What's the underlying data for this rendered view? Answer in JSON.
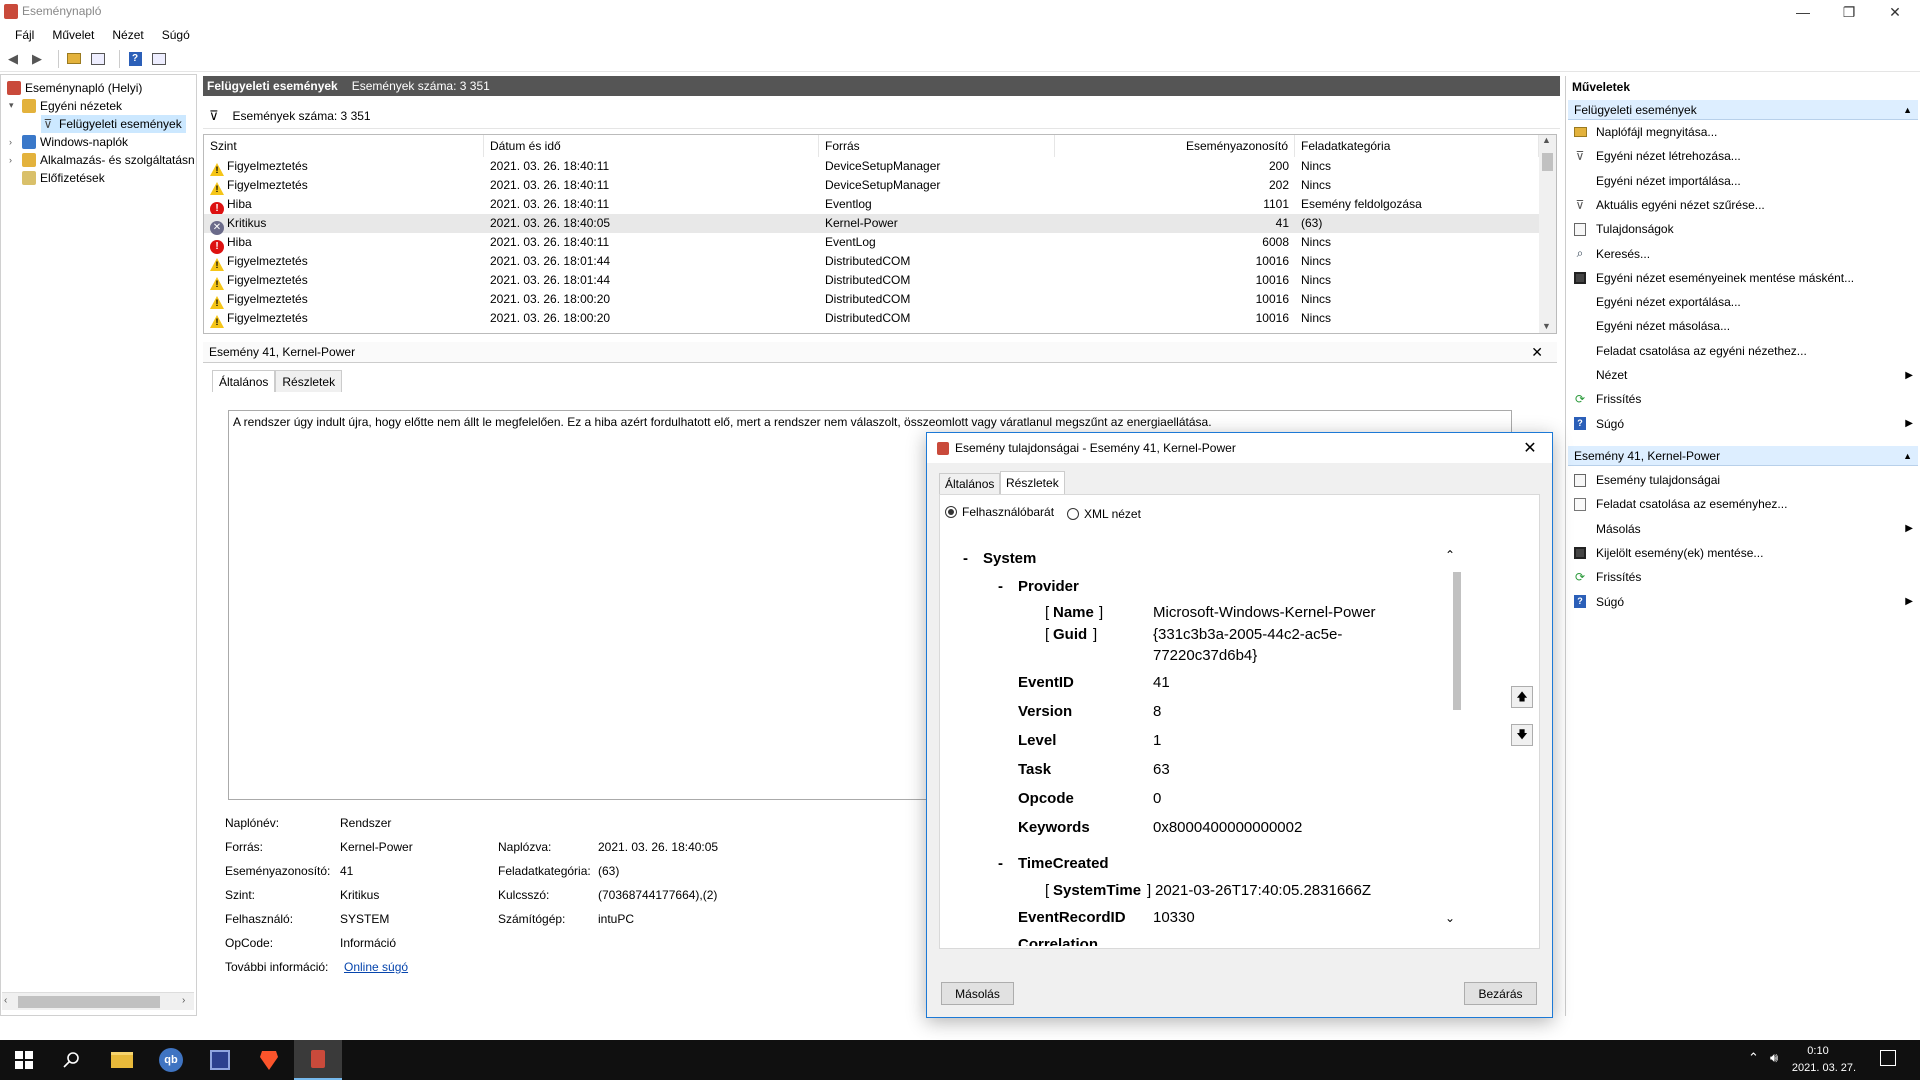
{
  "window": {
    "title": "Eseménynapló",
    "minimize": "—",
    "maximize": "❐",
    "close": "✕"
  },
  "menu": [
    "Fájl",
    "Művelet",
    "Nézet",
    "Súgó"
  ],
  "tree": {
    "root": "Eseménynapló (Helyi)",
    "custom_views": "Egyéni nézetek",
    "admin_events": "Felügyeleti események",
    "windows_logs": "Windows-naplók",
    "app_logs": "Alkalmazás- és szolgáltatásn",
    "subscriptions": "Előfizetések"
  },
  "center": {
    "header_title": "Felügyeleti események",
    "header_count": "Események száma: 3 351",
    "filter_text": "Események száma: 3 351"
  },
  "grid": {
    "columns": [
      "Szint",
      "Dátum és idő",
      "Forrás",
      "Eseményazonosító",
      "Feladatkategória"
    ],
    "rows": [
      {
        "level": "Figyelmeztetés",
        "type": "warn",
        "date": "2021. 03. 26. 18:40:11",
        "source": "DeviceSetupManager",
        "id": "200",
        "task": "Nincs"
      },
      {
        "level": "Figyelmeztetés",
        "type": "warn",
        "date": "2021. 03. 26. 18:40:11",
        "source": "DeviceSetupManager",
        "id": "202",
        "task": "Nincs"
      },
      {
        "level": "Hiba",
        "type": "err",
        "date": "2021. 03. 26. 18:40:11",
        "source": "Eventlog",
        "id": "1101",
        "task": "Esemény feldolgozása"
      },
      {
        "level": "Kritikus",
        "type": "crit",
        "date": "2021. 03. 26. 18:40:05",
        "source": "Kernel-Power",
        "id": "41",
        "task": "(63)"
      },
      {
        "level": "Hiba",
        "type": "err",
        "date": "2021. 03. 26. 18:40:11",
        "source": "EventLog",
        "id": "6008",
        "task": "Nincs"
      },
      {
        "level": "Figyelmeztetés",
        "type": "warn",
        "date": "2021. 03. 26. 18:01:44",
        "source": "DistributedCOM",
        "id": "10016",
        "task": "Nincs"
      },
      {
        "level": "Figyelmeztetés",
        "type": "warn",
        "date": "2021. 03. 26. 18:01:44",
        "source": "DistributedCOM",
        "id": "10016",
        "task": "Nincs"
      },
      {
        "level": "Figyelmeztetés",
        "type": "warn",
        "date": "2021. 03. 26. 18:00:20",
        "source": "DistributedCOM",
        "id": "10016",
        "task": "Nincs"
      },
      {
        "level": "Figyelmeztetés",
        "type": "warn",
        "date": "2021. 03. 26. 18:00:20",
        "source": "DistributedCOM",
        "id": "10016",
        "task": "Nincs"
      }
    ]
  },
  "detail": {
    "title": "Esemény 41, Kernel-Power",
    "tab_general": "Általános",
    "tab_details": "Részletek",
    "description": "A rendszer úgy indult újra, hogy előtte nem állt le megfelelően. Ez a hiba azért fordulhatott elő, mert a rendszer nem válaszolt, összeomlott vagy váratlanul megszűnt az energiaellátása.",
    "labels": {
      "log": "Naplónév:",
      "source": "Forrás:",
      "event_id": "Eseményazonosító:",
      "level": "Szint:",
      "user": "Felhasználó:",
      "opcode": "OpCode:",
      "more_info": "További információ:",
      "logged": "Naplózva:",
      "task": "Feladatkategória:",
      "keywords": "Kulcsszó:",
      "computer": "Számítógép:"
    },
    "values": {
      "log": "Rendszer",
      "source": "Kernel-Power",
      "event_id": "41",
      "level": "Kritikus",
      "user": "SYSTEM",
      "opcode": "Információ",
      "more_info": "Online súgó",
      "logged": "2021. 03. 26. 18:40:05",
      "task": "(63)",
      "keywords": "(70368744177664),(2)",
      "computer": "intuPC"
    }
  },
  "actions": {
    "title": "Műveletek",
    "section1": "Felügyeleti események",
    "items1": [
      {
        "label": "Naplófájl megnyitása...",
        "icon": "folder-icon",
        "arrow": false
      },
      {
        "label": "Egyéni nézet létrehozása...",
        "icon": "filter-icon",
        "arrow": false
      },
      {
        "label": "Egyéni nézet importálása...",
        "icon": "blank-icon",
        "arrow": false
      },
      {
        "label": "Aktuális egyéni nézet szűrése...",
        "icon": "filter-icon",
        "arrow": false
      },
      {
        "label": "Tulajdonságok",
        "icon": "properties-icon",
        "arrow": false
      },
      {
        "label": "Keresés...",
        "icon": "find-icon",
        "arrow": false
      },
      {
        "label": "Egyéni nézet eseményeinek mentése másként...",
        "icon": "save-icon",
        "arrow": false
      },
      {
        "label": "Egyéni nézet exportálása...",
        "icon": "blank-icon",
        "arrow": false
      },
      {
        "label": "Egyéni nézet másolása...",
        "icon": "blank-icon",
        "arrow": false
      },
      {
        "label": "Feladat csatolása az egyéni nézethez...",
        "icon": "blank-icon",
        "arrow": false
      },
      {
        "label": "Nézet",
        "icon": "blank-icon",
        "arrow": true
      },
      {
        "label": "Frissítés",
        "icon": "refresh-icon",
        "arrow": false
      },
      {
        "label": "Súgó",
        "icon": "help-icon",
        "arrow": true
      }
    ],
    "section2": "Esemény 41, Kernel-Power",
    "items2": [
      {
        "label": "Esemény tulajdonságai",
        "icon": "properties-icon",
        "arrow": false
      },
      {
        "label": "Feladat csatolása az eseményhez...",
        "icon": "task-icon",
        "arrow": false
      },
      {
        "label": "Másolás",
        "icon": "blank-icon",
        "arrow": true
      },
      {
        "label": "Kijelölt esemény(ek) mentése...",
        "icon": "save-icon",
        "arrow": false
      },
      {
        "label": "Frissítés",
        "icon": "refresh-icon",
        "arrow": false
      },
      {
        "label": "Súgó",
        "icon": "help-icon",
        "arrow": true
      }
    ]
  },
  "dialog": {
    "title": "Esemény tulajdonságai - Esemény 41, Kernel-Power",
    "tab_general": "Általános",
    "tab_details": "Részletek",
    "radio_friendly": "Felhasználóbarát",
    "radio_xml": "XML nézet",
    "system": "System",
    "provider": "Provider",
    "name_key": "Name",
    "name_val": "Microsoft-Windows-Kernel-Power",
    "guid_key": "Guid",
    "guid_val1": "{331c3b3a-2005-44c2-ac5e-",
    "guid_val2": "77220c37d6b4}",
    "fields": [
      {
        "k": "EventID",
        "v": "41"
      },
      {
        "k": "Version",
        "v": "8"
      },
      {
        "k": "Level",
        "v": "1"
      },
      {
        "k": "Task",
        "v": "63"
      },
      {
        "k": "Opcode",
        "v": "0"
      },
      {
        "k": "Keywords",
        "v": "0x8000400000000002"
      }
    ],
    "timecreated": "TimeCreated",
    "systemtime_key": "SystemTime",
    "systemtime_val": "2021-03-26T17:40:05.2831666Z",
    "recordid_key": "EventRecordID",
    "recordid_val": "10330",
    "correlation": "Correlation",
    "copy_btn": "Másolás",
    "close_btn": "Bezárás"
  },
  "taskbar": {
    "time": "0:10",
    "date": "2021. 03. 27."
  }
}
